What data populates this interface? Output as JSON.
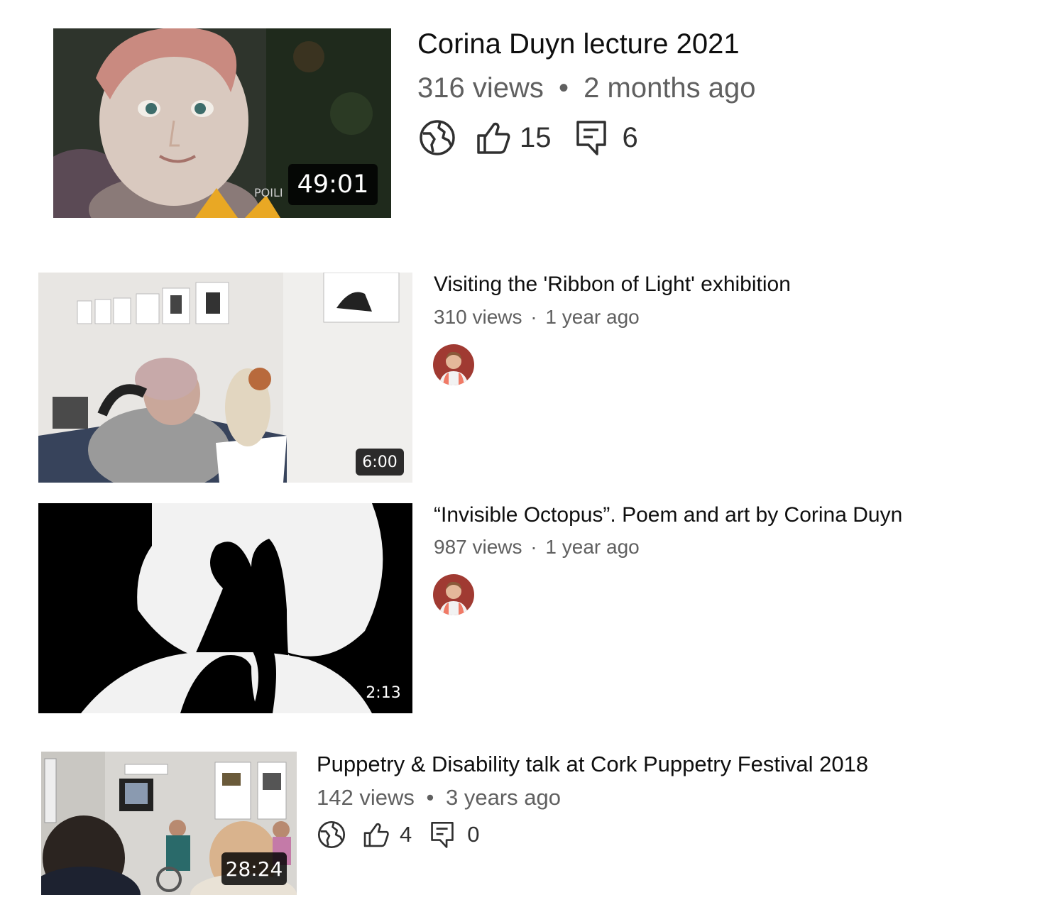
{
  "videos": [
    {
      "title": "Corina Duyn lecture 2021",
      "views": "316 views",
      "separator": "•",
      "age": "2 months ago",
      "duration": "49:01",
      "thumb_caption": "POILI",
      "likes": "15",
      "comments": "6",
      "visibility_icon": "globe-icon"
    },
    {
      "title": "Visiting the 'Ribbon of Light' exhibition",
      "views": "310 views",
      "separator": "·",
      "age": "1 year ago",
      "duration": "6:00"
    },
    {
      "title": "“Invisible Octopus”. Poem and art by Corina Duyn",
      "views": "987 views",
      "separator": "·",
      "age": "1 year ago",
      "duration": "2:13"
    },
    {
      "title": "Puppetry & Disability talk at Cork Puppetry Festival 2018",
      "views": "142 views",
      "separator": "•",
      "age": "3 years ago",
      "duration": "28:24",
      "likes": "4",
      "comments": "0",
      "visibility_icon": "globe-icon"
    }
  ],
  "colors": {
    "title": "#0f0f0f",
    "meta": "#606060",
    "duration_bg": "#000000"
  }
}
